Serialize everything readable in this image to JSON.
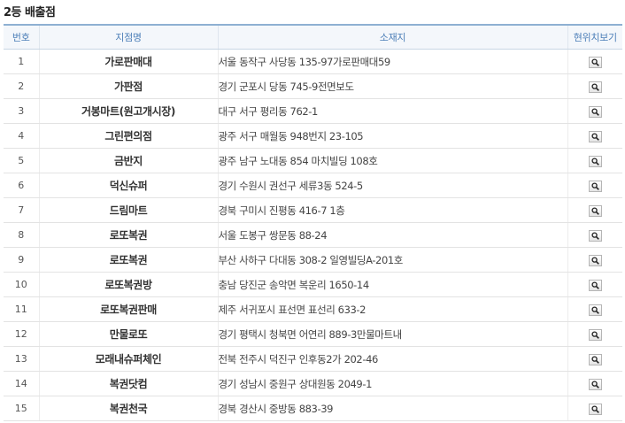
{
  "page": {
    "title": "2등 배출점"
  },
  "table": {
    "headers": {
      "no": "번호",
      "name": "지점명",
      "address": "소재지",
      "view": "현위치보기"
    },
    "rows": [
      {
        "no": "1",
        "name": "가로판매대",
        "address": "서울 동작구 사당동 135-97가로판매대59"
      },
      {
        "no": "2",
        "name": "가판점",
        "address": "경기 군포시 당동 745-9전면보도"
      },
      {
        "no": "3",
        "name": "거봉마트(원고개시장)",
        "address": "대구 서구 평리동 762-1"
      },
      {
        "no": "4",
        "name": "그린편의점",
        "address": "광주 서구 매월동 948번지 23-105"
      },
      {
        "no": "5",
        "name": "금반지",
        "address": "광주 남구 노대동 854 마치빌딩 108호"
      },
      {
        "no": "6",
        "name": "덕신슈퍼",
        "address": "경기 수원시 권선구 세류3동 524-5"
      },
      {
        "no": "7",
        "name": "드림마트",
        "address": "경북 구미시 진평동 416-7 1층"
      },
      {
        "no": "8",
        "name": "로또복권",
        "address": "서울 도봉구 쌍문동 88-24"
      },
      {
        "no": "9",
        "name": "로또복권",
        "address": "부산 사하구 다대동 308-2 일영빌딩A-201호"
      },
      {
        "no": "10",
        "name": "로또복권방",
        "address": "충남 당진군 송악면 복운리 1650-14"
      },
      {
        "no": "11",
        "name": "로또복권판매",
        "address": "제주 서귀포시 표선면 표선리 633-2"
      },
      {
        "no": "12",
        "name": "만물로또",
        "address": "경기 평택시 청북면 어연리 889-3만물마트내"
      },
      {
        "no": "13",
        "name": "모래내슈퍼체인",
        "address": "전북 전주시 덕진구 인후동2가 202-46"
      },
      {
        "no": "14",
        "name": "복권닷컴",
        "address": "경기 성남시 중원구 상대원동 2049-1"
      },
      {
        "no": "15",
        "name": "복권천국",
        "address": "경북 경산시 중방동 883-39"
      }
    ]
  },
  "icons": {
    "view_button": "magnifier-icon"
  }
}
